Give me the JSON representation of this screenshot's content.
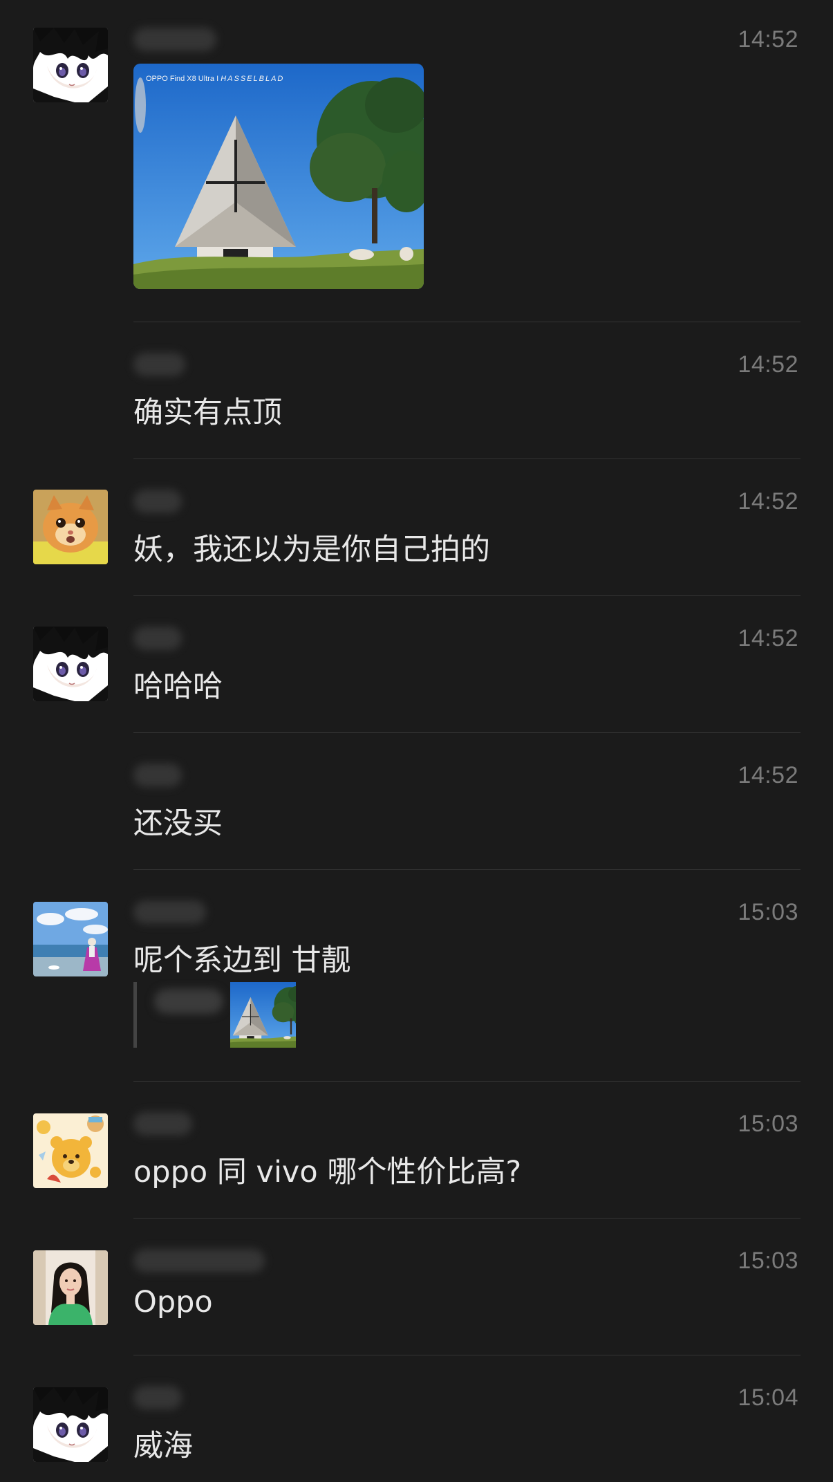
{
  "messages": [
    {
      "time": "14:52",
      "type": "image",
      "avatar": "anime-boy",
      "image_caption": {
        "model": "OPPO Find X8 Ultra",
        "separator": "I",
        "brand": "HASSELBLAD"
      }
    },
    {
      "time": "14:52",
      "type": "text",
      "text": "确实有点顶"
    },
    {
      "time": "14:52",
      "type": "text",
      "avatar": "orange-cat",
      "text": "妖，我还以为是你自己拍的"
    },
    {
      "time": "14:52",
      "type": "text",
      "avatar": "anime-boy",
      "text": "哈哈哈"
    },
    {
      "time": "14:52",
      "type": "text",
      "text": "还没买"
    },
    {
      "time": "15:03",
      "type": "text-with-quote",
      "avatar": "beach-scene",
      "text": "呢个系边到 甘靓"
    },
    {
      "time": "15:03",
      "type": "text",
      "avatar": "winnie-pooh",
      "text": "oppo 同 vivo 哪个性价比高?"
    },
    {
      "time": "15:03",
      "type": "text",
      "avatar": "woman-photo",
      "text": "Oppo"
    },
    {
      "time": "15:04",
      "type": "text",
      "avatar": "anime-boy",
      "text": "威海"
    }
  ],
  "colors": {
    "background": "#1b1b1b",
    "divider": "#343434",
    "text": "#e8e8e8",
    "timestamp": "#7b7b7b"
  }
}
